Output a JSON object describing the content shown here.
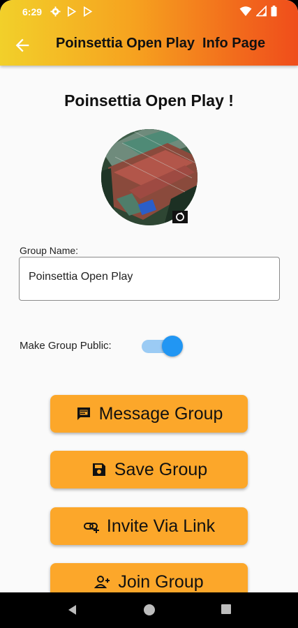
{
  "status_bar": {
    "time": "6:29"
  },
  "app_bar": {
    "title": "Poinsettia Open Play  Info Page"
  },
  "header": {
    "title": "Poinsettia Open Play !"
  },
  "form": {
    "group_name_label": "Group Name:",
    "group_name_value": "Poinsettia Open Play",
    "public_label": "Make Group Public:",
    "public_toggle_on": true
  },
  "buttons": {
    "message": "Message Group",
    "save": "Save Group",
    "invite": "Invite Via Link",
    "join": "Join Group"
  },
  "colors": {
    "gradient_start": "#f2d02a",
    "gradient_end": "#ef4d1b",
    "button_bg": "#fca72a",
    "toggle_on": "#2196f3"
  },
  "icons": {
    "back": "arrow-left-icon",
    "message": "chat-icon",
    "save": "floppy-disk-icon",
    "invite": "link-icon",
    "join": "add-person-icon",
    "camera": "camera-icon"
  }
}
